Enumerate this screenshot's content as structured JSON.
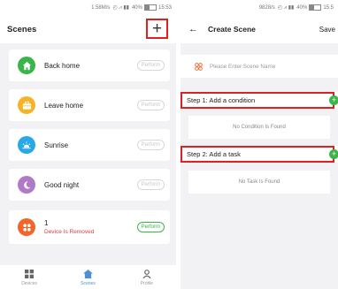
{
  "left": {
    "status": {
      "speed": "1.58M/s",
      "battery": "40%",
      "time": "15:53"
    },
    "title": "Scenes",
    "add_glyph": "+",
    "scenes": [
      {
        "name": "Back home",
        "sub": "",
        "perform": "Perform",
        "icon": "home-icon",
        "color": "#3ab54a",
        "active": false
      },
      {
        "name": "Leave home",
        "sub": "",
        "perform": "Perform",
        "icon": "briefcase-icon",
        "color": "#f6b327",
        "active": false
      },
      {
        "name": "Sunrise",
        "sub": "",
        "perform": "Perform",
        "icon": "sunrise-icon",
        "color": "#29a8e8",
        "active": false
      },
      {
        "name": "Good night",
        "sub": "",
        "perform": "Perform",
        "icon": "moon-icon",
        "color": "#b07ac9",
        "active": false
      },
      {
        "name": "1",
        "sub": "Device Is Removed",
        "perform": "Perform",
        "icon": "grid-icon",
        "color": "#f0662b",
        "active": true
      }
    ],
    "tabs": [
      {
        "label": "Devices",
        "icon": "grid-tab-icon",
        "active": false
      },
      {
        "label": "Scenes",
        "icon": "home-tab-icon",
        "active": true
      },
      {
        "label": "Profile",
        "icon": "profile-tab-icon",
        "active": false
      }
    ]
  },
  "right": {
    "status": {
      "speed": "9828/s",
      "battery": "40%",
      "time": "15:5"
    },
    "title": "Create Scene",
    "back_glyph": "←",
    "save_label": "Save",
    "name_placeholder": "Please Enter Scene Name",
    "step1_label": "Step 1: Add a condition",
    "step1_empty": "No Condition Is Found",
    "step2_label": "Step 2: Add a task",
    "step2_empty": "No Task Is Found",
    "add_glyph": "+"
  },
  "colors": {
    "accent_red": "#e02020",
    "green": "#39b54a",
    "tab_active": "#4a90d9"
  }
}
